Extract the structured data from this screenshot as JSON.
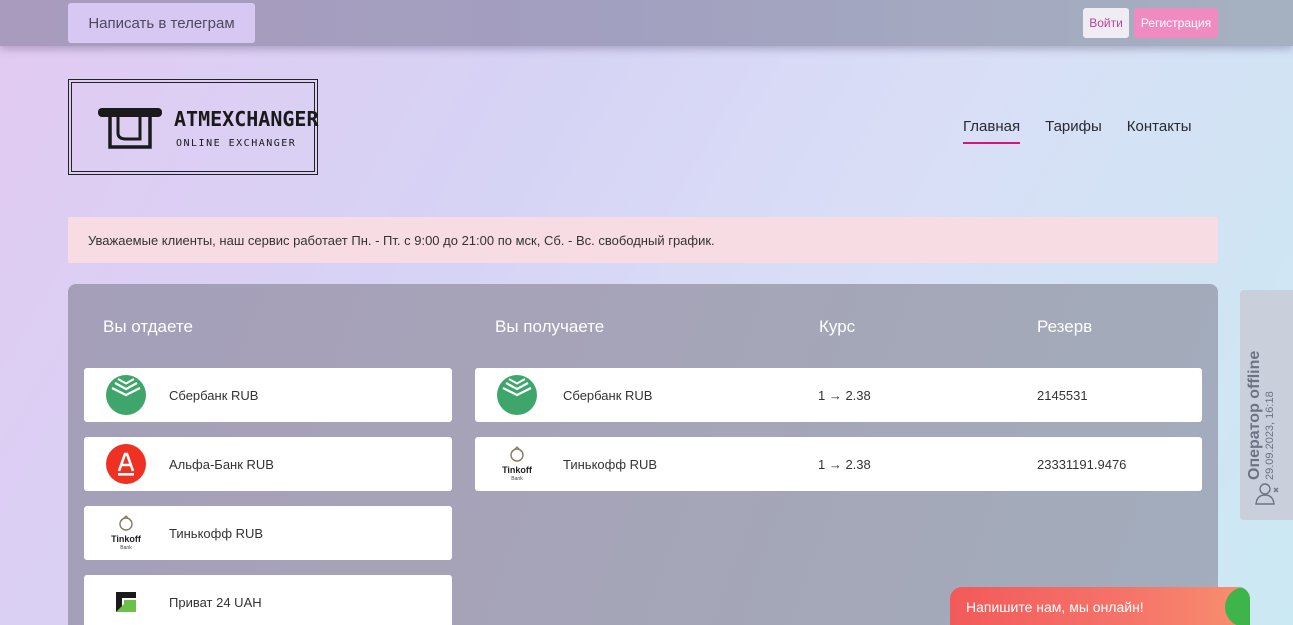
{
  "topbar": {
    "telegram_label": "Написать в телеграм",
    "login_label": "Войти",
    "register_label": "Регистрация"
  },
  "logo": {
    "title": "ATMEXCHANGER",
    "subtitle": "ONLINE EXCHANGER"
  },
  "nav": {
    "items": [
      {
        "label": "Главная",
        "active": true
      },
      {
        "label": "Тарифы",
        "active": false
      },
      {
        "label": "Контакты",
        "active": false
      }
    ]
  },
  "notice": {
    "text": "Уважаемые клиенты, наш сервис работает Пн. - Пт. с 9:00 до 21:00 по мск, Сб. - Вс. свободный график."
  },
  "exchange": {
    "headers": {
      "give": "Вы отдаете",
      "get": "Вы получаете",
      "rate": "Курс",
      "reserve": "Резерв"
    },
    "give_list": [
      {
        "name": "Сбербанк RUB",
        "icon": "sberbank-icon"
      },
      {
        "name": "Альфа-Банк RUB",
        "icon": "alfa-bank-icon"
      },
      {
        "name": "Тинькофф RUB",
        "icon": "tinkoff-icon"
      },
      {
        "name": "Приват 24 UAH",
        "icon": "privat24-icon"
      }
    ],
    "get_list": [
      {
        "name": "Сбербанк RUB",
        "icon": "sberbank-icon",
        "rate": "1 → 2.38",
        "reserve": "2145531"
      },
      {
        "name": "Тинькофф RUB",
        "icon": "tinkoff-icon",
        "rate": "1 → 2.38",
        "reserve": "23331191.9476"
      }
    ]
  },
  "operator": {
    "status": "Оператор offline",
    "datetime": "29.09.2023, 16:18"
  },
  "chat": {
    "label": "Напишите нам, мы онлайн!"
  },
  "colors": {
    "accent": "#d4147a",
    "register_button": "#f08bc2",
    "chat_bubble": "#f25a5a",
    "sber_green": "#3fa66b",
    "alfa_red": "#ef3124"
  }
}
